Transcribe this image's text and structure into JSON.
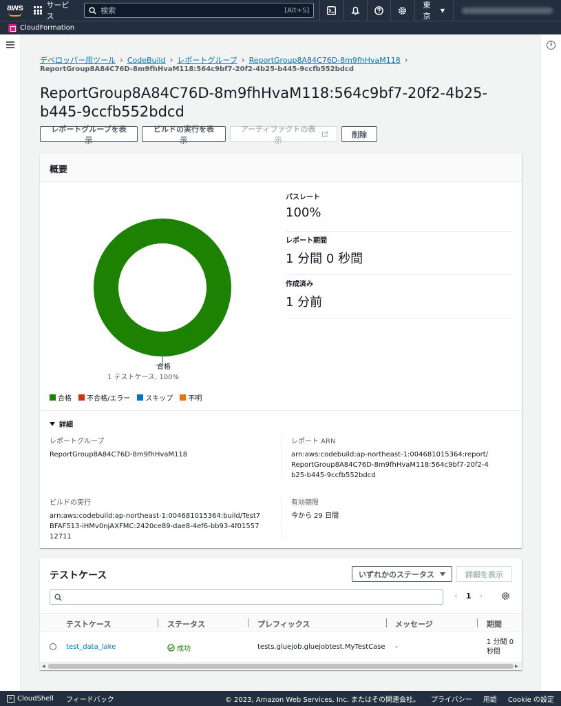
{
  "topnav": {
    "logo_text": "aws",
    "services_label": "サービス",
    "search_placeholder": "検索",
    "search_shortcut": "[Alt+S]",
    "region_label": "東京"
  },
  "favorites": {
    "cloudformation_label": "CloudFormation"
  },
  "breadcrumb": {
    "items": [
      "デベロッパー用ツール",
      "CodeBuild",
      "レポートグループ",
      "ReportGroup8A84C76D-8m9fhHvaM118"
    ],
    "current": "ReportGroup8A84C76D-8m9fhHvaM118:564c9bf7-20f2-4b25-b445-9ccfb552bdcd"
  },
  "page_title": "ReportGroup8A84C76D-8m9fhHvaM118:564c9bf7-20f2-4b25-b445-9ccfb552bdcd",
  "actions": {
    "view_report_group": "レポートグループを表示",
    "view_build_run": "ビルドの実行を表示",
    "view_artifacts": "アーティファクトの表示",
    "delete": "削除"
  },
  "summary": {
    "heading": "概要",
    "donut": {
      "label": "合格",
      "sublabel": "1 テストケース, 100%",
      "pass_fraction": 1.0,
      "color": "#1d8102"
    },
    "legend": [
      {
        "label": "合格",
        "color": "#1d8102"
      },
      {
        "label": "不合格/エラー",
        "color": "#d13212"
      },
      {
        "label": "スキップ",
        "color": "#0073bb"
      },
      {
        "label": "不明",
        "color": "#ec7211"
      }
    ],
    "metrics": [
      {
        "key": "パスレート",
        "value": "100%"
      },
      {
        "key": "レポート期間",
        "value": "1 分間 0 秒間"
      },
      {
        "key": "作成済み",
        "value": "1 分前"
      }
    ],
    "details": {
      "toggle_label": "詳細",
      "report_group_key": "レポートグループ",
      "report_group_value": "ReportGroup8A84C76D-8m9fhHvaM118",
      "report_arn_key": "レポート ARN",
      "report_arn_value": "arn:aws:codebuild:ap-northeast-1:004681015364:report/ReportGroup8A84C76D-8m9fhHvaM118:564c9bf7-20f2-4b25-b445-9ccfb552bdcd",
      "build_run_key": "ビルドの実行",
      "build_run_value": "arn:aws:codebuild:ap-northeast-1:004681015364:build/Test7BFAF513-iHMv0njAXFMC:2420ce89-dae8-4ef6-bb93-4f0155712711",
      "expiry_key": "有効期限",
      "expiry_value": "今から 29 日間"
    }
  },
  "testcases": {
    "heading": "テストケース",
    "status_filter": "いずれかのステータス",
    "details_button": "詳細を表示",
    "search_placeholder": "",
    "page_current": "1",
    "columns": [
      "テストケース",
      "ステータス",
      "プレフィックス",
      "メッセージ",
      "期間"
    ],
    "rows": [
      {
        "name": "test_data_lake",
        "status": "成功",
        "prefix": "tests.gluejob.gluejobtest.MyTestCase",
        "message": "-",
        "duration": "1 分間 0 秒間"
      }
    ]
  },
  "footer": {
    "cloudshell": "CloudShell",
    "feedback": "フィードバック",
    "copyright": "© 2023, Amazon Web Services, Inc. またはその関連会社。",
    "privacy": "プライバシー",
    "terms": "用語",
    "cookie": "Cookie の設定"
  }
}
